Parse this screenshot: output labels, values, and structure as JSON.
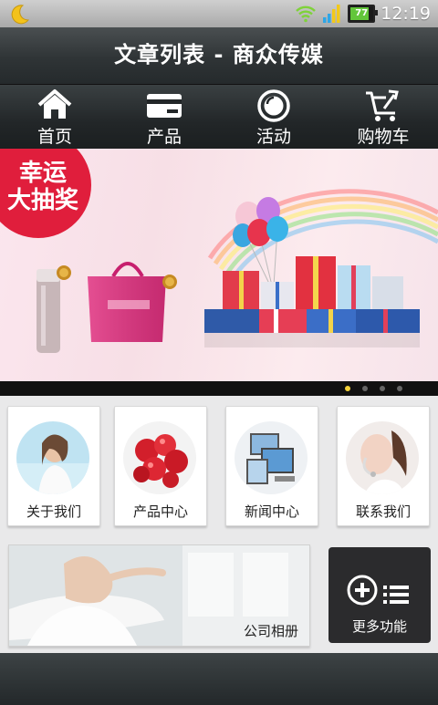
{
  "status_bar": {
    "time": "12:19",
    "battery_level": "77",
    "battery_fraction": 0.77
  },
  "header": {
    "title": "文章列表 - 商众传媒"
  },
  "nav": [
    {
      "label": "首页",
      "icon": "home-icon"
    },
    {
      "label": "产品",
      "icon": "card-icon"
    },
    {
      "label": "活动",
      "icon": "disc-icon"
    },
    {
      "label": "购物车",
      "icon": "cart-icon"
    }
  ],
  "banner": {
    "badge_line1": "幸运",
    "badge_line2": "大抽奖",
    "slide_count": 4,
    "active_slide": 1
  },
  "grid": [
    {
      "label": "关于我们"
    },
    {
      "label": "产品中心"
    },
    {
      "label": "新闻中心"
    },
    {
      "label": "联系我们"
    }
  ],
  "album": {
    "label": "公司相册"
  },
  "more": {
    "label": "更多功能"
  },
  "colors": {
    "accent_red": "#e01e3c",
    "dot_active": "#f4d23a",
    "bar_dark": "#2a2f31"
  }
}
